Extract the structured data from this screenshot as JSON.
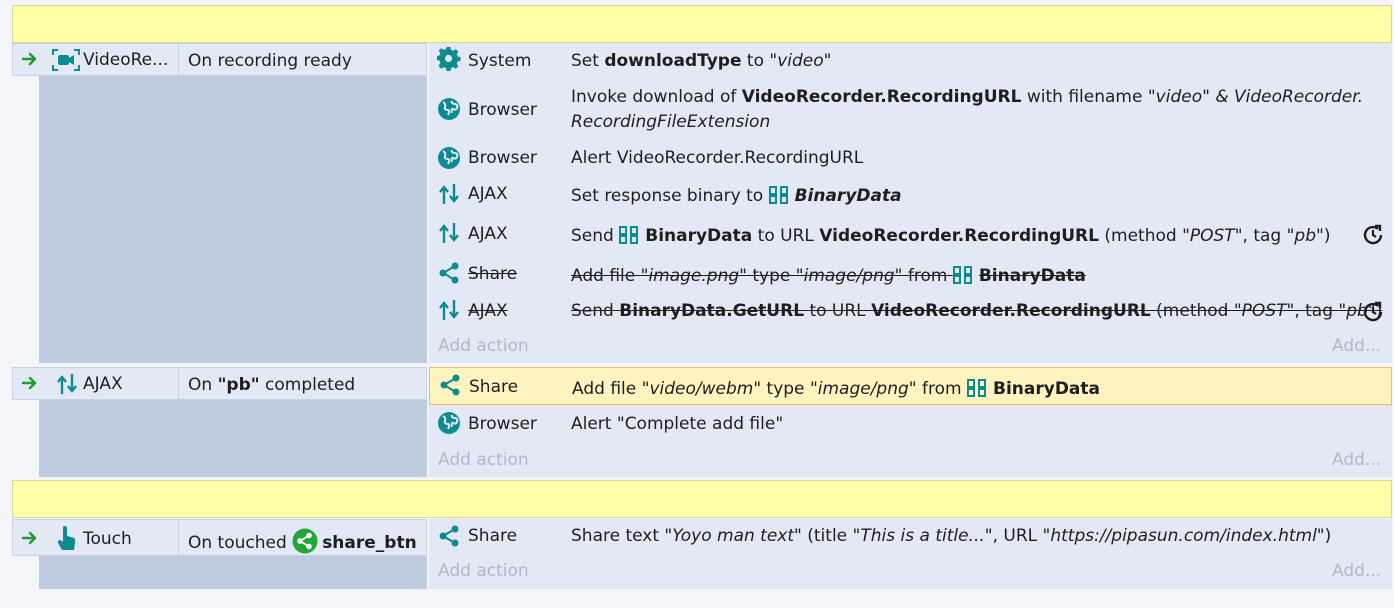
{
  "colors": {
    "comment": "#ffffa8",
    "header": "#e2e9f4",
    "sidebar": "#bfccdf",
    "rows": "#e3e9f4",
    "selected": "#fff3c0",
    "accent": "#0f8a8f",
    "arrow": "#1e9b32"
  },
  "events": [
    {
      "trigger_object": "VideoRe...",
      "trigger_icon": "video-recorder-icon",
      "condition": "On recording ready",
      "actions": [
        {
          "object": "System",
          "icon": "gear-icon",
          "parts": [
            "Set ",
            "downloadType",
            " to ",
            "\"video\""
          ]
        },
        {
          "object": "Browser",
          "icon": "globe-icon",
          "line1": [
            "Invoke download of ",
            "VideoRecorder.RecordingURL",
            " with filename ",
            "\"video\" & VideoRecorder."
          ],
          "line2": "RecordingFileExtension"
        },
        {
          "object": "Browser",
          "icon": "globe-icon",
          "text": "Alert VideoRecorder.RecordingURL"
        },
        {
          "object": "AJAX",
          "icon": "ajax-icon",
          "parts": [
            "Set response binary to ",
            "BinaryData"
          ]
        },
        {
          "object": "AJAX",
          "icon": "ajax-icon",
          "parts": [
            "Send ",
            "BinaryData",
            " to URL ",
            "VideoRecorder.RecordingURL",
            " (method ",
            "\"POST\"",
            ", tag ",
            "\"pb\"",
            ")"
          ]
        },
        {
          "object": "Share",
          "icon": "share-icon",
          "disabled": true,
          "parts": [
            "Add file ",
            "\"image.png\"",
            " type ",
            "\"image/png\"",
            " from ",
            "BinaryData"
          ]
        },
        {
          "object": "AJAX",
          "icon": "ajax-icon",
          "disabled": true,
          "parts": [
            "Send ",
            "BinaryData.GetURL",
            " to URL ",
            "VideoRecorder.RecordingURL",
            " (method ",
            "\"POST\"",
            ", tag ",
            "\"pb\"",
            ")"
          ]
        }
      ],
      "add_action": "Add action",
      "add_more": "Add..."
    },
    {
      "trigger_object": "AJAX",
      "trigger_icon": "ajax-icon",
      "condition_parts": [
        "On ",
        "\"pb\"",
        " completed"
      ],
      "actions": [
        {
          "object": "Share",
          "icon": "share-icon",
          "selected": true,
          "parts": [
            "Add file ",
            "\"video/webm\"",
            " type ",
            "\"image/png\"",
            " from ",
            "BinaryData"
          ]
        },
        {
          "object": "Browser",
          "icon": "globe-icon",
          "text": "Alert \"Complete add file\""
        }
      ],
      "add_action": "Add action",
      "add_more": "Add..."
    },
    {
      "trigger_object": "Touch",
      "trigger_icon": "touch-icon",
      "condition_parts": [
        "On touched ",
        "share_btn"
      ],
      "actions": [
        {
          "object": "Share",
          "icon": "share-icon",
          "parts": [
            "Share text ",
            "\"Yoyo man text\"",
            " (title ",
            "\"This is a title...\"",
            ", URL ",
            "\"https://pipasun.com/index.html\"",
            ")"
          ]
        }
      ],
      "add_action": "Add action",
      "add_more": "Add..."
    }
  ]
}
